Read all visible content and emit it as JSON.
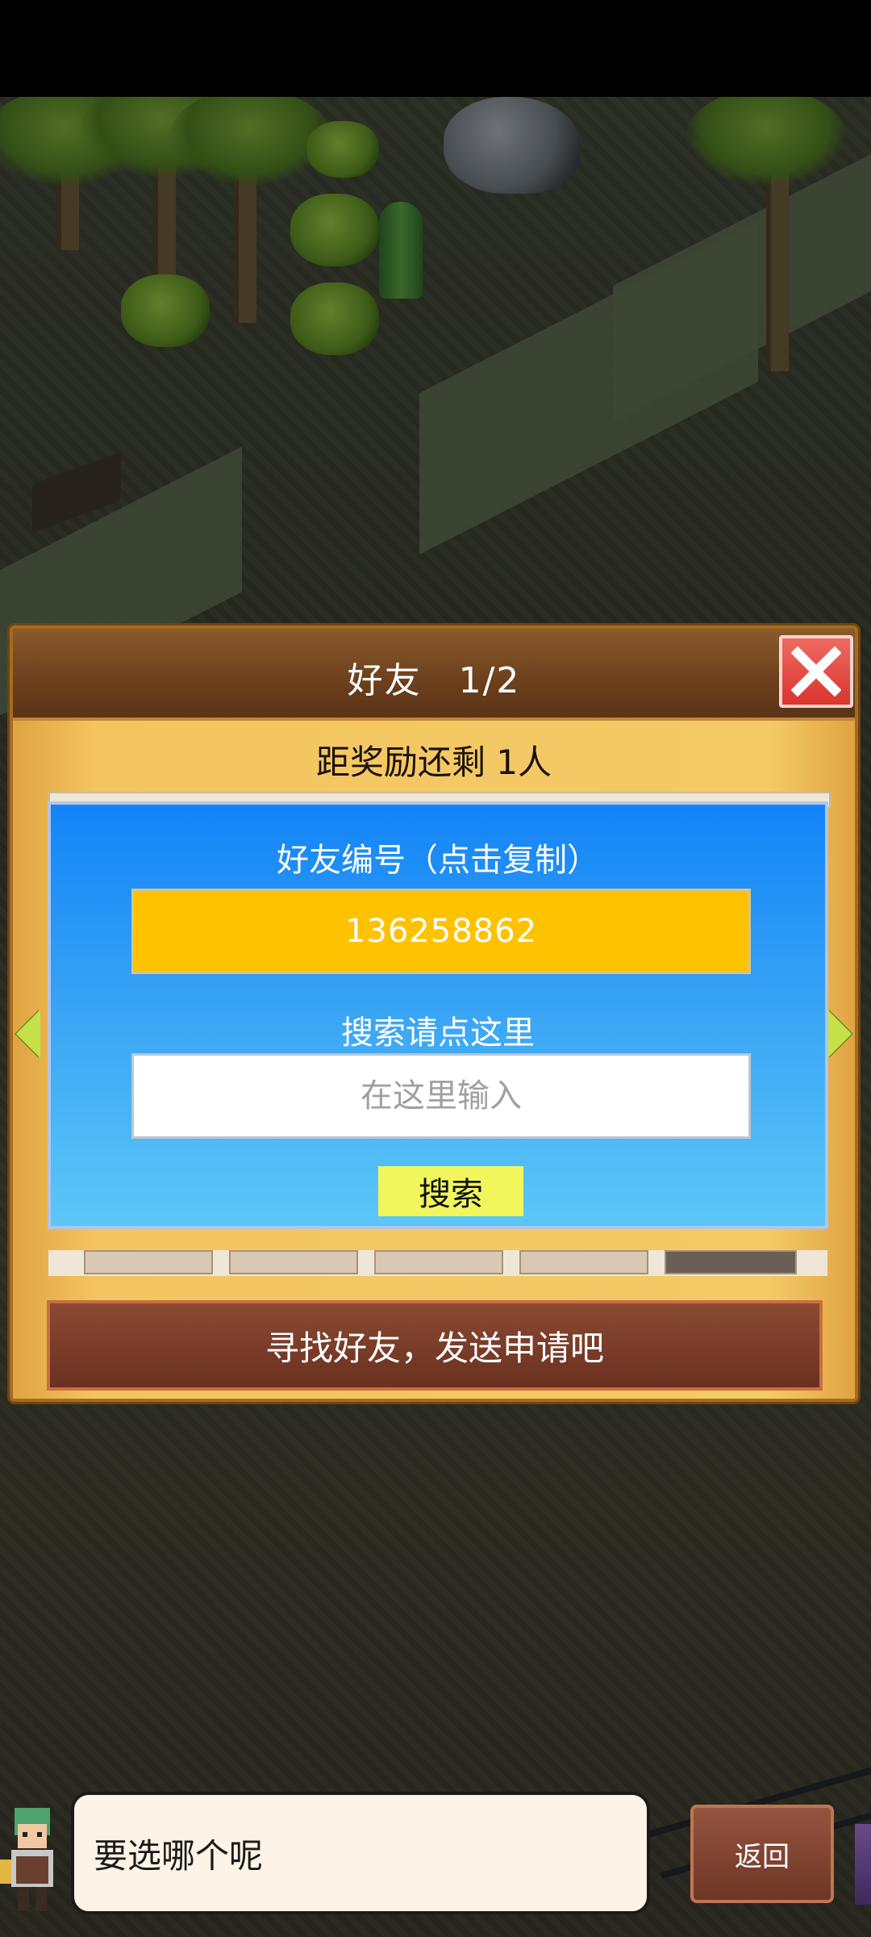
{
  "dialog": {
    "title": "好友　1/2",
    "reward_text": "距奖励还剩 1人",
    "find_friends_label": "寻找好友，发送申请吧"
  },
  "search_panel": {
    "friend_id_label": "好友编号（点击复制）",
    "friend_id_value": "136258862",
    "search_label": "搜索请点这里",
    "search_placeholder": "在这里输入",
    "search_button_label": "搜索"
  },
  "bottom_bar": {
    "speech_text": "要选哪个呢",
    "back_button_label": "返回"
  },
  "icons": {
    "close": "close-icon",
    "prev": "arrow-left-icon",
    "next": "arrow-right-icon"
  },
  "colors": {
    "friend_id_bg": "#ffc200",
    "search_button_bg": "#f0f65c",
    "close_button": "#e04a42",
    "panel_blue": "#1284f7"
  }
}
